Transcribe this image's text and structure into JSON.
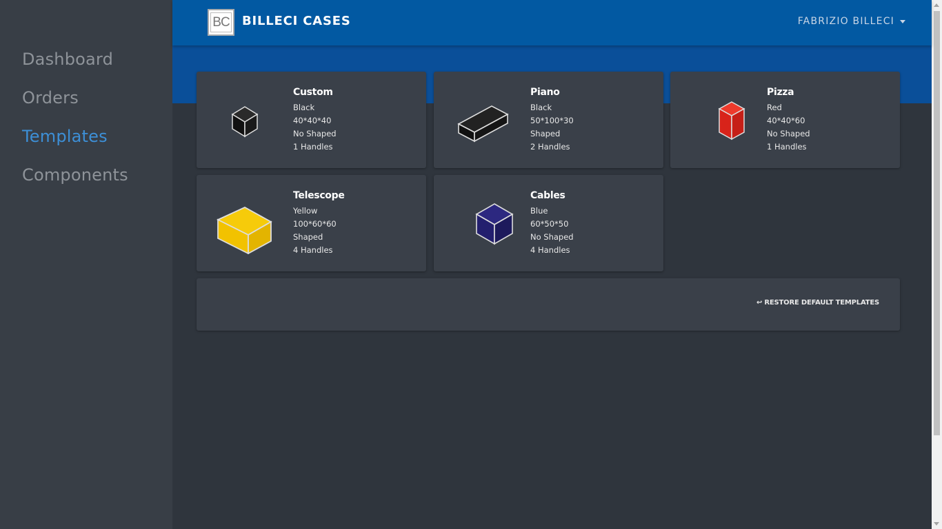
{
  "sidebar": {
    "items": [
      {
        "label": "Dashboard",
        "active": false
      },
      {
        "label": "Orders",
        "active": false
      },
      {
        "label": "Templates",
        "active": true
      },
      {
        "label": "Components",
        "active": false
      }
    ]
  },
  "header": {
    "logo_text": "BC",
    "brand": "BILLECI CASES",
    "user": "FABRIZIO BILLECI"
  },
  "templates": [
    {
      "name": "Custom",
      "color": "Black",
      "size": "40*40*40",
      "shape": "No Shaped",
      "handles": "1 Handles",
      "box_color": "#111111",
      "icon": "cube-icon"
    },
    {
      "name": "Piano",
      "color": "Black",
      "size": "50*100*30",
      "shape": "Shaped",
      "handles": "2 Handles",
      "box_color": "#111111",
      "icon": "long-box-icon"
    },
    {
      "name": "Pizza",
      "color": "Red",
      "size": "40*40*60",
      "shape": "No Shaped",
      "handles": "1 Handles",
      "box_color": "#e0241b",
      "icon": "tall-box-icon"
    },
    {
      "name": "Telescope",
      "color": "Yellow",
      "size": "100*60*60",
      "shape": "Shaped",
      "handles": "4 Handles",
      "box_color": "#f2c200",
      "icon": "wide-box-icon"
    },
    {
      "name": "Cables",
      "color": "Blue",
      "size": "60*50*50",
      "shape": "No Shaped",
      "handles": "4 Handles",
      "box_color": "#231f6e",
      "icon": "cube-icon"
    }
  ],
  "restore_label": "↩ RESTORE DEFAULT TEMPLATES",
  "colors": {
    "accent": "#3d8fd6",
    "header": "#0259a2",
    "sidebar": "#383e46",
    "background": "#2f353d",
    "card": "#3a4049"
  }
}
